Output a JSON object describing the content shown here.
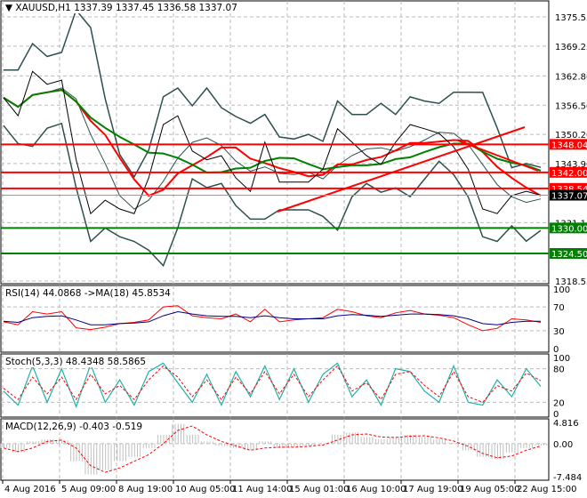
{
  "header": {
    "symbol": "XAUUSD,H1",
    "ohlc": "1337.39 1337.45 1336.58 1337.07",
    "menu_icon": "triangle-down-icon"
  },
  "price_axis": {
    "min": 1318.55,
    "max": 1375.55,
    "ticks": [
      "1375.55",
      "1369.25",
      "1362.80",
      "1356.50",
      "1350.20",
      "1343.90",
      "1331.15",
      "1318.55"
    ],
    "levels": [
      {
        "label": "1348.04",
        "value": 1348.04,
        "color": "#ff0000"
      },
      {
        "label": "1342.00",
        "value": 1342.0,
        "color": "#ff0000"
      },
      {
        "label": "1338.54",
        "value": 1338.54,
        "color": "#ff0000"
      },
      {
        "label": "1330.00",
        "value": 1330.0,
        "color": "#008000"
      },
      {
        "label": "1324.50",
        "value": 1324.5,
        "color": "#008000"
      }
    ],
    "current": {
      "label": "1337.07",
      "value": 1337.07,
      "color": "#000000"
    }
  },
  "price_series": [
    1358.1,
    1354.2,
    1363.8,
    1361.0,
    1361.9,
    1344.7,
    1333.1,
    1336.0,
    1334.1,
    1333.1,
    1340.8,
    1352.3,
    1354.2,
    1346.6,
    1344.7,
    1345.6,
    1340.8,
    1337.9,
    1348.5,
    1339.9,
    1339.9,
    1339.9,
    1342.7,
    1351.4,
    1348.5,
    1345.6,
    1343.7,
    1348.5,
    1352.3,
    1351.4,
    1350.4,
    1347.5,
    1342.7,
    1334.1,
    1333.1,
    1337.0,
    1337.9,
    1337.07
  ],
  "rsi": {
    "label": "RSI(14) 44.0868  ->MA(18) 45.8534",
    "ticks": [
      "100",
      "70",
      "30",
      "0"
    ],
    "values": [
      45,
      40,
      62,
      58,
      62,
      35,
      32,
      36,
      42,
      44,
      48,
      70,
      72,
      55,
      52,
      50,
      58,
      45,
      66,
      45,
      48,
      50,
      52,
      66,
      62,
      55,
      52,
      60,
      64,
      58,
      56,
      52,
      40,
      30,
      34,
      50,
      48,
      44
    ],
    "ma": [
      46,
      44,
      52,
      54,
      55,
      48,
      40,
      40,
      42,
      43,
      45,
      55,
      62,
      58,
      55,
      54,
      54,
      52,
      55,
      52,
      50,
      50,
      50,
      55,
      57,
      56,
      54,
      56,
      58,
      58,
      57,
      55,
      50,
      42,
      40,
      44,
      46,
      45.85
    ]
  },
  "stoch": {
    "label": "Stoch(5,3,3) 48.4348 58.5865",
    "ticks": [
      "100",
      "80",
      "20",
      "0"
    ],
    "values": [
      40,
      15,
      85,
      20,
      80,
      12,
      88,
      20,
      60,
      15,
      75,
      90,
      55,
      20,
      70,
      15,
      75,
      30,
      85,
      25,
      80,
      20,
      70,
      90,
      30,
      60,
      15,
      80,
      75,
      40,
      20,
      85,
      20,
      15,
      60,
      30,
      80,
      48.4
    ],
    "signal": [
      45,
      25,
      65,
      35,
      65,
      25,
      70,
      35,
      50,
      25,
      60,
      85,
      65,
      30,
      60,
      25,
      65,
      35,
      75,
      35,
      70,
      30,
      60,
      85,
      40,
      55,
      25,
      70,
      75,
      50,
      30,
      75,
      30,
      20,
      50,
      40,
      72,
      58.6
    ]
  },
  "macd": {
    "label": "MACD(12,26,9) -0.403 -0.519",
    "ticks": [
      "4.816",
      "0.00",
      "-7.484"
    ],
    "min": -7.484,
    "max": 4.816,
    "values": [
      -1,
      -2,
      0.5,
      1,
      0.8,
      -4,
      -7,
      -6,
      -4,
      -3,
      -1,
      2,
      4.5,
      2,
      0.5,
      -0.5,
      -1,
      -1.5,
      0.5,
      -1,
      -0.8,
      -0.5,
      0,
      2,
      2.5,
      1.5,
      1,
      1.5,
      2,
      1.5,
      1,
      0.2,
      -1.5,
      -3,
      -3.5,
      -2,
      -1,
      -0.4
    ],
    "signal": [
      -1,
      -1.8,
      -1,
      0.5,
      0.8,
      -1,
      -5,
      -6.5,
      -5.5,
      -4,
      -2.5,
      0,
      3,
      4,
      2,
      0.5,
      -0.5,
      -1.5,
      -1,
      -0.8,
      -0.8,
      -0.6,
      -0.3,
      0.8,
      2,
      2.2,
      1.5,
      1.4,
      1.7,
      1.8,
      1.3,
      0.6,
      -0.6,
      -2.2,
      -3.2,
      -2.8,
      -1.5,
      -0.52
    ]
  },
  "time_axis": [
    "4 Aug 2016",
    "5 Aug 09:00",
    "8 Aug 19:00",
    "10 Aug 05:00",
    "11 Aug 14:00",
    "15 Aug 01:00",
    "16 Aug 10:00",
    "17 Aug 19:00",
    "19 Aug 05:00",
    "22 Aug 15:00"
  ],
  "colors": {
    "price": "#000000",
    "bands": "#2f4f4f",
    "ma_fast": "#ff0000",
    "ma_slow": "#008000",
    "rsi": "#ff0000",
    "rsi_ma": "#000080",
    "stoch": "#20b2aa",
    "macd_hist": "#c0c0c0"
  }
}
